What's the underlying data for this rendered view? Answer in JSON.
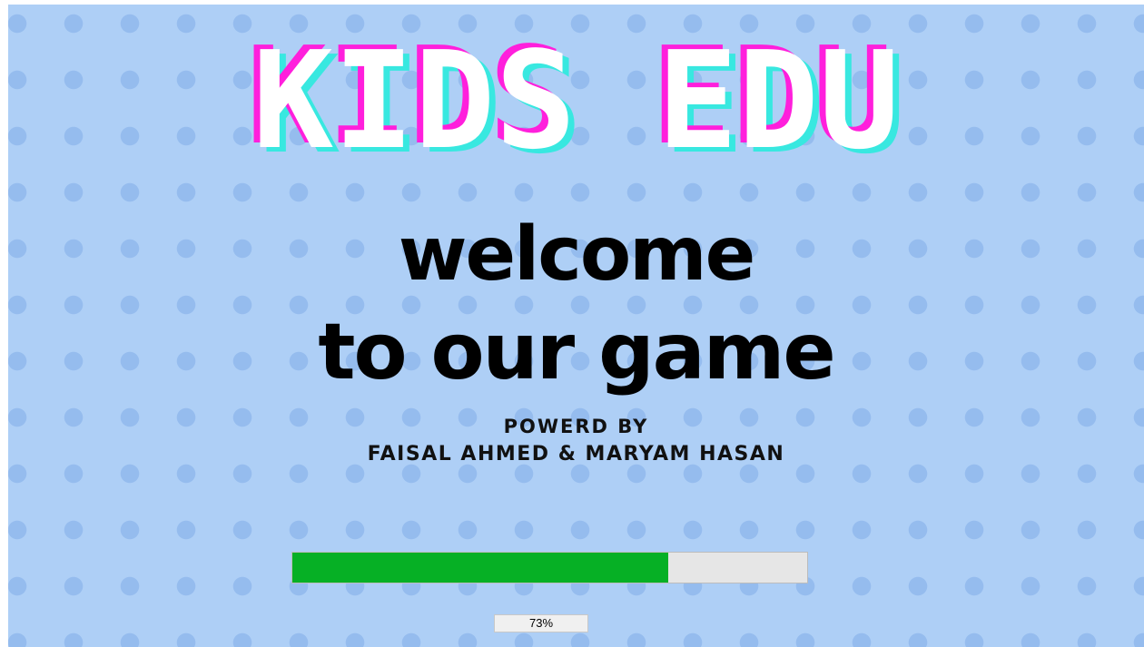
{
  "splash": {
    "title": "KIDS EDU",
    "welcome_line_1": "welcome",
    "welcome_line_2": "to our game",
    "powered_by": "POWERD BY",
    "authors": "FAISAL AHMED & MARYAM HASAN"
  },
  "progress": {
    "value_percent": 73,
    "label": "73%"
  },
  "colors": {
    "background": "#aecff6",
    "dots": "#95bcee",
    "title_fill": "#ffffff",
    "title_shadow_magenta": "#ff1fdc",
    "title_shadow_cyan": "#38e8e0",
    "progress_fill": "#06b025",
    "progress_track": "#e6e6e6"
  }
}
